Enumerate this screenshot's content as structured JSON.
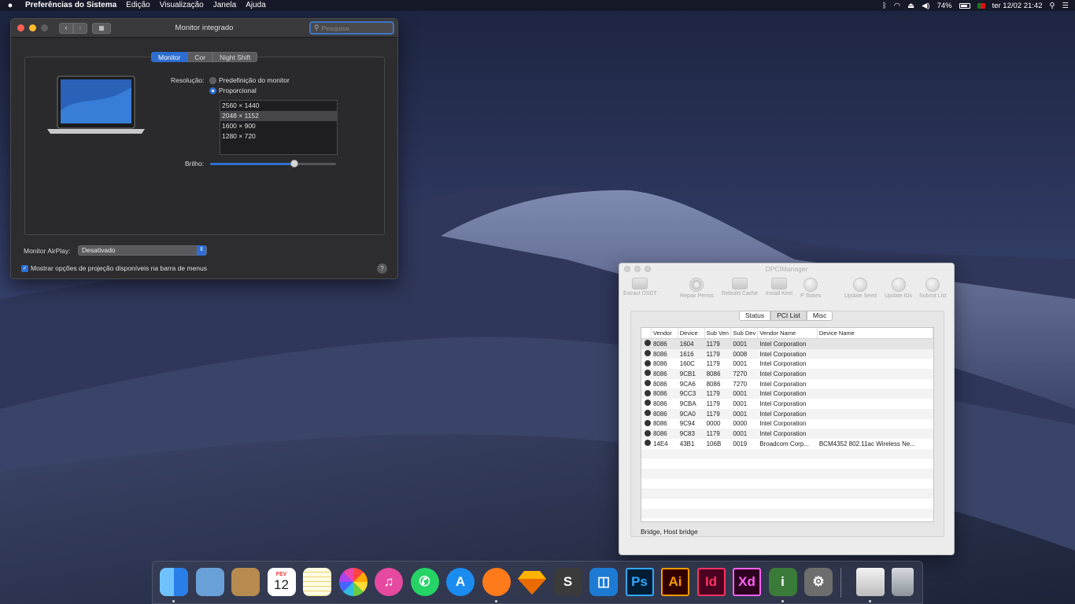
{
  "menubar": {
    "app_name": "Preferências do Sistema",
    "menus": [
      "Edição",
      "Visualização",
      "Janela",
      "Ajuda"
    ],
    "battery": "74%",
    "datetime": "ter 12/02  21:42"
  },
  "prefs": {
    "title": "Monitor integrado",
    "search_placeholder": "Pesquisa",
    "tabs": [
      "Monitor",
      "Cor",
      "Night Shift"
    ],
    "resolution_label": "Resolução:",
    "option_default": "Predefinição do monitor",
    "option_scaled": "Proporcional",
    "resolutions": [
      "2560 × 1440",
      "2048 × 1152",
      "1600 × 900",
      "1280 × 720"
    ],
    "selected_resolution_index": 1,
    "brightness_label": "Brilho:",
    "brightness": 0.67,
    "airplay_label": "Monitor AirPlay:",
    "airplay_value": "Desativado",
    "mirroring_checkbox_label": "Mostrar opções de projeção disponíveis na barra de menus",
    "help": "?"
  },
  "dpci": {
    "title": "DPCIManager",
    "toolbar": [
      "Extract DSDT",
      "Repair Perms",
      "Rebuild Cache",
      "Install Kext",
      "P States",
      "Update Seed",
      "Update IDs",
      "Submit List"
    ],
    "tabs": [
      "Status",
      "PCI List",
      "Misc"
    ],
    "active_tab": "PCI List",
    "columns": [
      "Vendor",
      "Device",
      "Sub Ven",
      "Sub Dev",
      "Vendor Name",
      "Device Name"
    ],
    "rows": [
      [
        "8086",
        "1604",
        "1179",
        "0001",
        "Intel Corporation",
        ""
      ],
      [
        "8086",
        "1616",
        "1179",
        "0008",
        "Intel Corporation",
        ""
      ],
      [
        "8086",
        "160C",
        "1179",
        "0001",
        "Intel Corporation",
        ""
      ],
      [
        "8086",
        "9CB1",
        "8086",
        "7270",
        "Intel Corporation",
        ""
      ],
      [
        "8086",
        "9CA6",
        "8086",
        "7270",
        "Intel Corporation",
        ""
      ],
      [
        "8086",
        "9CC3",
        "1179",
        "0001",
        "Intel Corporation",
        ""
      ],
      [
        "8086",
        "9CBA",
        "1179",
        "0001",
        "Intel Corporation",
        ""
      ],
      [
        "8086",
        "9CA0",
        "1179",
        "0001",
        "Intel Corporation",
        ""
      ],
      [
        "8086",
        "9C94",
        "0000",
        "0000",
        "Intel Corporation",
        ""
      ],
      [
        "8086",
        "9C83",
        "1179",
        "0001",
        "Intel Corporation",
        ""
      ],
      [
        "14E4",
        "43B1",
        "106B",
        "0019",
        "Broadcom Corp...",
        "BCM4352 802.11ac Wireless Ne..."
      ]
    ],
    "status_text": "Bridge, Host bridge"
  },
  "dock": {
    "calendar_month": "FEV",
    "calendar_day": "12",
    "items": [
      {
        "name": "finder",
        "label": "",
        "color": "#3d8ef0"
      },
      {
        "name": "preview",
        "label": "",
        "color": "#6aa0d8"
      },
      {
        "name": "contacts",
        "label": "",
        "color": "#b78b4f"
      },
      {
        "name": "calendar",
        "label": "",
        "color": "#ffffff"
      },
      {
        "name": "notes",
        "label": "",
        "color": "#f5d64a"
      },
      {
        "name": "photos",
        "label": "",
        "color": "#ffffff"
      },
      {
        "name": "itunes",
        "label": "♫",
        "color": "#e64aa0"
      },
      {
        "name": "whatsapp",
        "label": "✆",
        "color": "#25d366"
      },
      {
        "name": "app-store",
        "label": "A",
        "color": "#1a8cf0"
      },
      {
        "name": "firefox",
        "label": "",
        "color": "#ff7a1a"
      },
      {
        "name": "sketch",
        "label": "",
        "color": "#f7b500"
      },
      {
        "name": "sublime-text",
        "label": "S",
        "color": "#3b3b3b"
      },
      {
        "name": "ide",
        "label": "◫",
        "color": "#1d7bd4"
      },
      {
        "name": "photoshop",
        "label": "Ps",
        "color": "#001d34"
      },
      {
        "name": "illustrator",
        "label": "Ai",
        "color": "#330000"
      },
      {
        "name": "indesign",
        "label": "Id",
        "color": "#49021f"
      },
      {
        "name": "adobe-xd",
        "label": "Xd",
        "color": "#2e001f"
      },
      {
        "name": "system-information",
        "label": "i",
        "color": "#3a7b3a"
      },
      {
        "name": "system-preferences",
        "label": "⚙",
        "color": "#6d6d6d"
      },
      {
        "name": "downloads",
        "label": "",
        "color": "#dddddd"
      },
      {
        "name": "trash",
        "label": "",
        "color": "#9aa0a8"
      }
    ]
  }
}
